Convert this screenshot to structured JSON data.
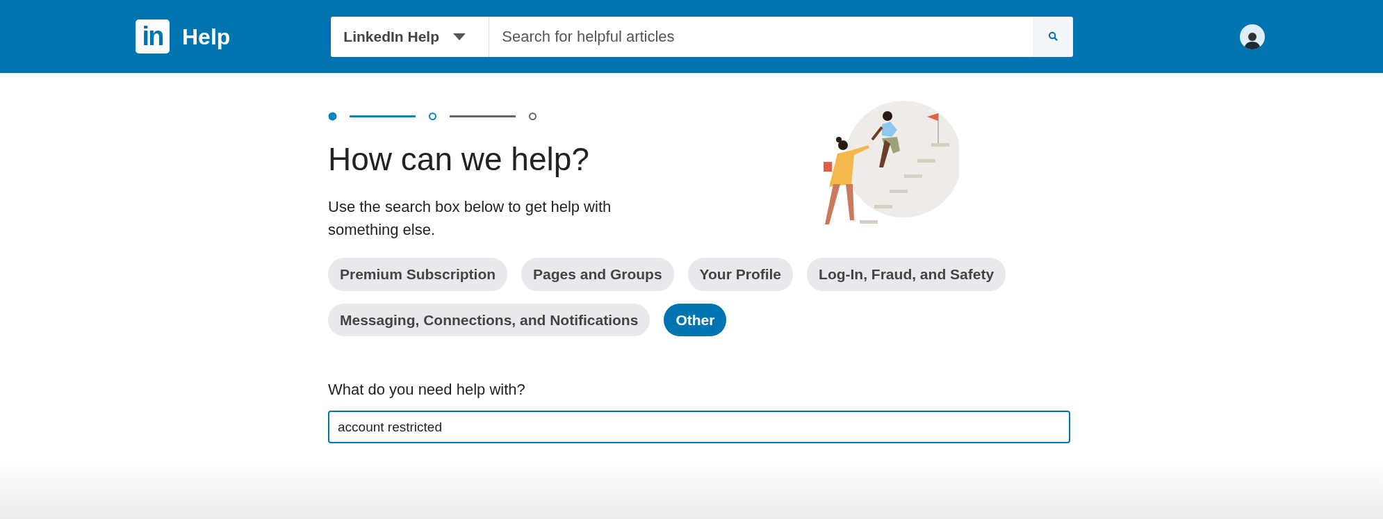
{
  "header": {
    "brand_mark": "in",
    "title": "Help",
    "scope_dropdown": "LinkedIn Help",
    "search": {
      "placeholder": "Search for helpful articles"
    }
  },
  "steps": [
    {
      "kind": "complete"
    },
    {
      "kind": "active"
    },
    {
      "kind": "pending"
    }
  ],
  "heading": "How can we help?",
  "intro": "Use the search box below to get help with something else.",
  "topics": [
    {
      "label": "Premium Subscription",
      "selected": false
    },
    {
      "label": "Pages and Groups",
      "selected": false
    },
    {
      "label": "Your Profile",
      "selected": false
    },
    {
      "label": "Log-In, Fraud, and Safety",
      "selected": false
    },
    {
      "label": "Messaging, Connections, and Notifications",
      "selected": false
    },
    {
      "label": "Other",
      "selected": true
    }
  ],
  "question": {
    "label": "What do you need help with?",
    "value": "account restricted"
  }
}
